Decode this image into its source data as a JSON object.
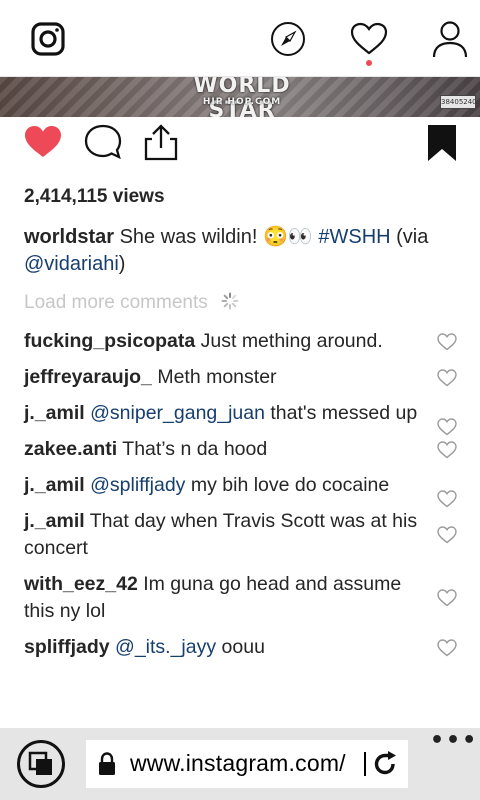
{
  "topbar": {
    "icons": [
      "instagram-icon",
      "compass-icon",
      "heart-icon",
      "profile-icon"
    ]
  },
  "media": {
    "watermark": "WORLD STAR",
    "watermark_sub": "HIP HOP.COM",
    "box_code": "38405240"
  },
  "post": {
    "views": "2,414,115 views",
    "caption": {
      "username": "worldstar",
      "text": " She was wildin! 😳👀 ",
      "hashtag": "#WSHH",
      "via_text": " (via ",
      "mention": "@vidariahi",
      "close": ")"
    },
    "load_more": "Load more comments"
  },
  "comments": [
    {
      "user": "fucking_psicopata",
      "text": " Just mething around."
    },
    {
      "user": "jeffreyaraujo_",
      "text": " Meth monster"
    },
    {
      "user": "j._amil",
      "mention": "@sniper_gang_juan",
      "text": " that's messed up"
    },
    {
      "user": "zakee.anti",
      "text": " That’s n da hood"
    },
    {
      "user": "j._amil",
      "mention": "@spliffjady",
      "text": " my bih love do cocaine"
    },
    {
      "user": "j._amil",
      "text": " That day when Travis Scott was at his concert"
    },
    {
      "user": "with_eez_42",
      "text": " Im guna go head and assume this ny lol"
    },
    {
      "user": "spliffjady",
      "mention": "@_its._jayy",
      "text": " oouu"
    }
  ],
  "browser": {
    "url": "www.instagram.com/",
    "more": "•••"
  },
  "colors": {
    "like_red": "#ed4956",
    "link_blue": "#163f6e",
    "muted": "#c7c7c7"
  }
}
